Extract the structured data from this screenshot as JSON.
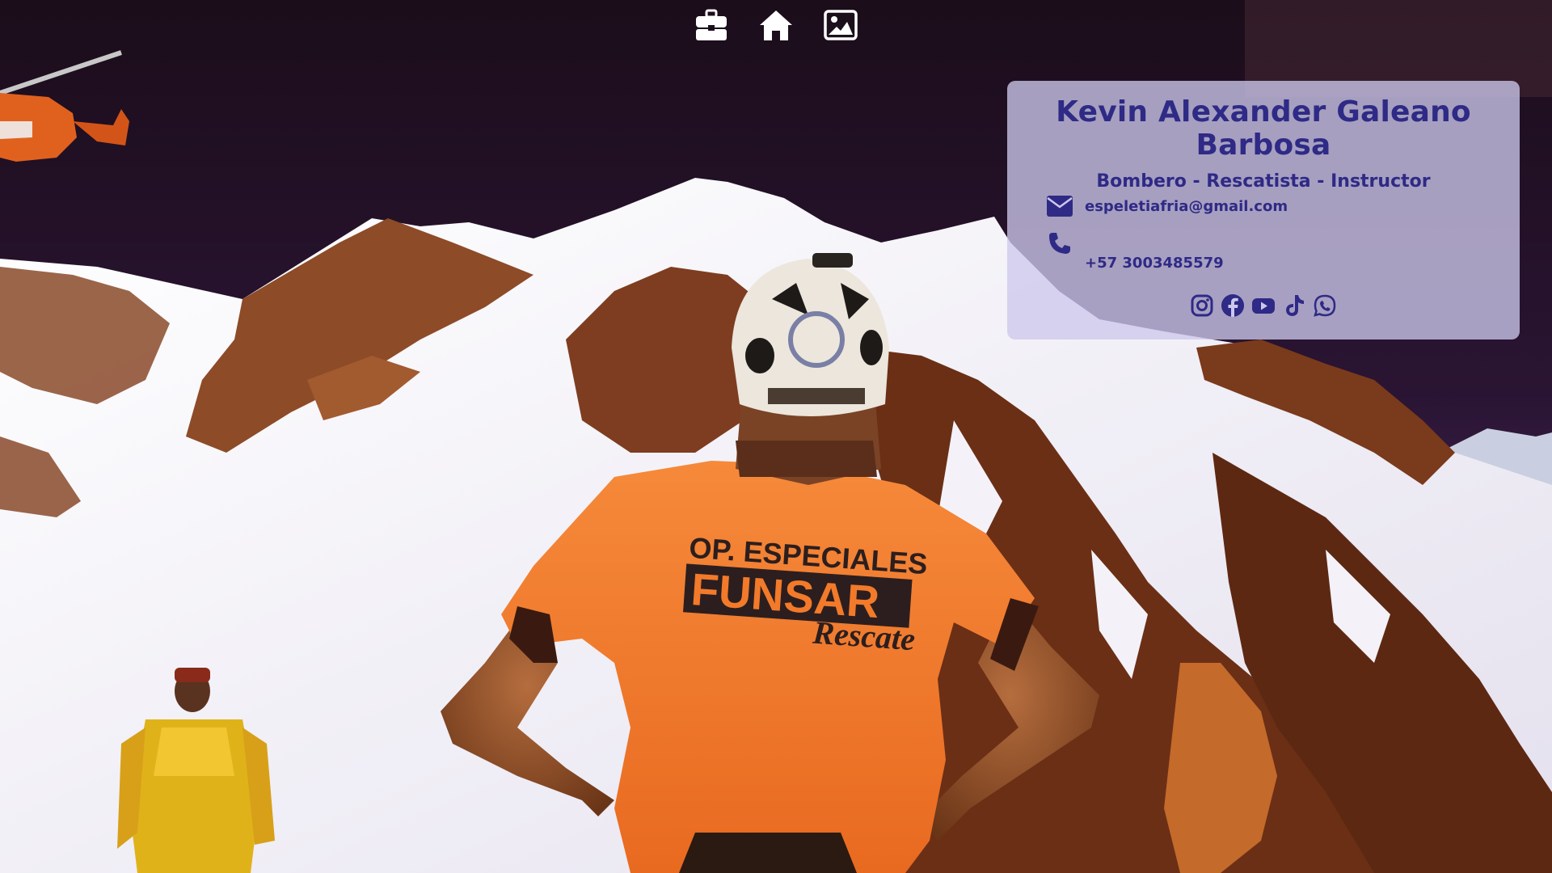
{
  "nav": {
    "items": [
      {
        "icon": "briefcase-icon",
        "label": "Portfolio"
      },
      {
        "icon": "home-icon",
        "label": "Home"
      },
      {
        "icon": "image-icon",
        "label": "Gallery"
      }
    ]
  },
  "profile": {
    "name": "Kevin Alexander Galeano Barbosa",
    "role": "Bombero - Rescatista - Instructor",
    "email": "espeletiafria@gmail.com",
    "phone": "+57 3003485579",
    "socials": [
      "instagram-icon",
      "facebook-icon",
      "youtube-icon",
      "tiktok-icon",
      "whatsapp-icon"
    ]
  },
  "photo": {
    "shirt_line1": "OP. ESPECIALES",
    "shirt_line2": "FUNSAR",
    "shirt_line3": "Rescate"
  },
  "colors": {
    "accent": "#2e2a86",
    "card_bg": "#cdc8ec",
    "nav_icon": "#ffffff",
    "shirt": "#f27a2a"
  }
}
